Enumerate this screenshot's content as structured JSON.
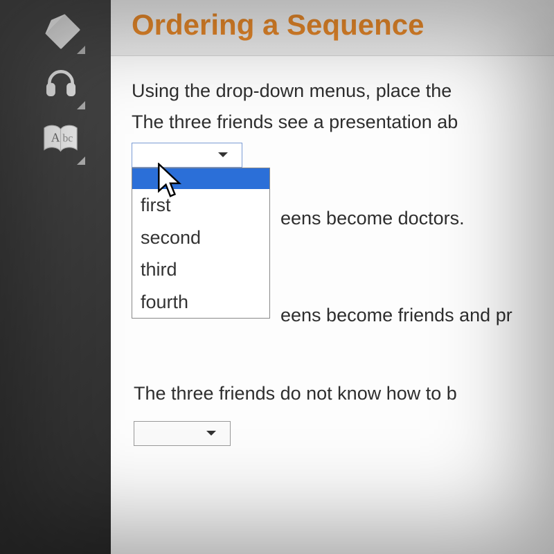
{
  "title": "Ordering a Sequence",
  "instructions_line1": "Using the drop-down menus, place the",
  "instructions_line2": "The three friends see a presentation ab",
  "dropdown": {
    "blank": "",
    "options": [
      "first",
      "second",
      "third",
      "fourth"
    ]
  },
  "rows": {
    "r1": "eens become doctors.",
    "r2": "eens become friends and pr",
    "r3": "The three friends do not know how to b"
  },
  "sidebar": {
    "pencil": "pencil",
    "headphones": "headphones",
    "book": "glossary"
  }
}
